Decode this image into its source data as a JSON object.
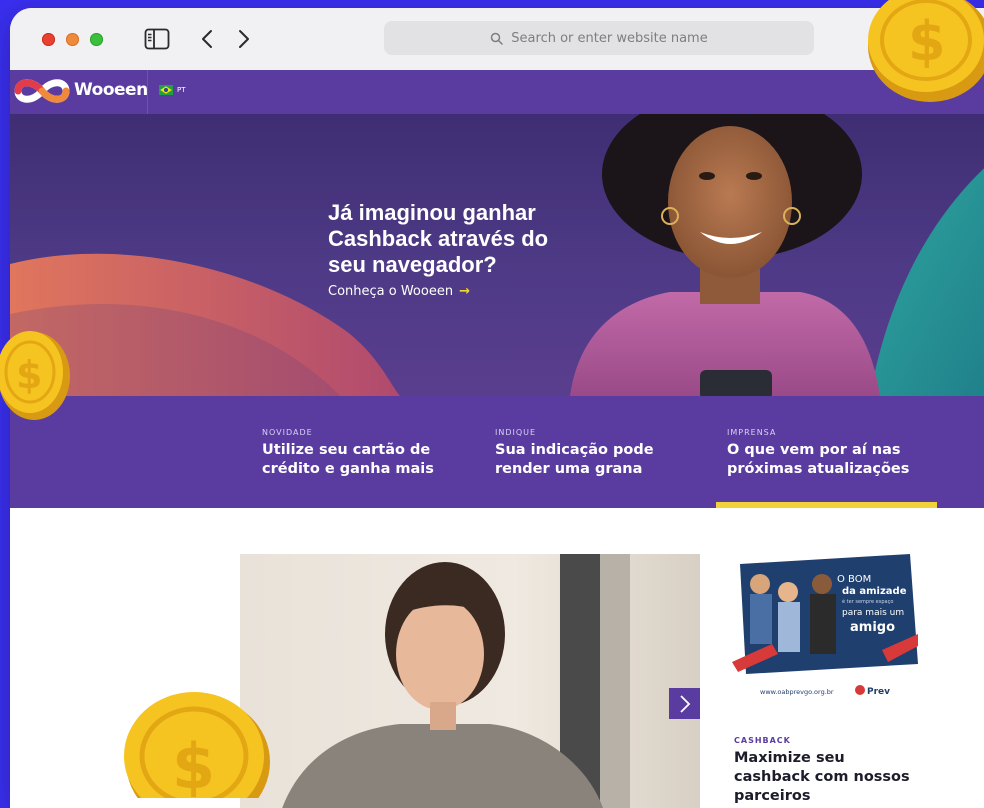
{
  "browser": {
    "url_placeholder": "Search or enter website name",
    "icons": [
      "close-dot",
      "minimize-dot",
      "zoom-dot",
      "sidebar-icon",
      "back-arrow-icon",
      "forward-arrow-icon",
      "search-icon"
    ]
  },
  "site": {
    "brand": "Wooeen",
    "language": "PT",
    "colors": {
      "primary": "#5a3ca0",
      "accent": "#f2d23a"
    }
  },
  "hero": {
    "title": "Já imaginou ganhar Cashback através do seu navegador?",
    "cta": "Conheça o Wooeen",
    "cta_arrow": "→"
  },
  "features": [
    {
      "kicker": "NOVIDADE",
      "title": "Utilize seu cartão de crédito e ganha mais"
    },
    {
      "kicker": "INDIQUE",
      "title": "Sua indicação pode render uma grana"
    },
    {
      "kicker": "IMPRENSA",
      "title": "O que vem por aí nas próximas atualizações"
    }
  ],
  "promo_ad": {
    "headline_1": "O BOM",
    "headline_2": "da amizade",
    "headline_3": "é ter sempre espaço",
    "headline_4": "para mais um",
    "headline_5": "amigo",
    "site": "www.oabprevgo.org.br",
    "logo_text": "Prev"
  },
  "article": {
    "kicker": "CASHBACK",
    "title": "Maximize seu cashback com nossos parceiros"
  }
}
